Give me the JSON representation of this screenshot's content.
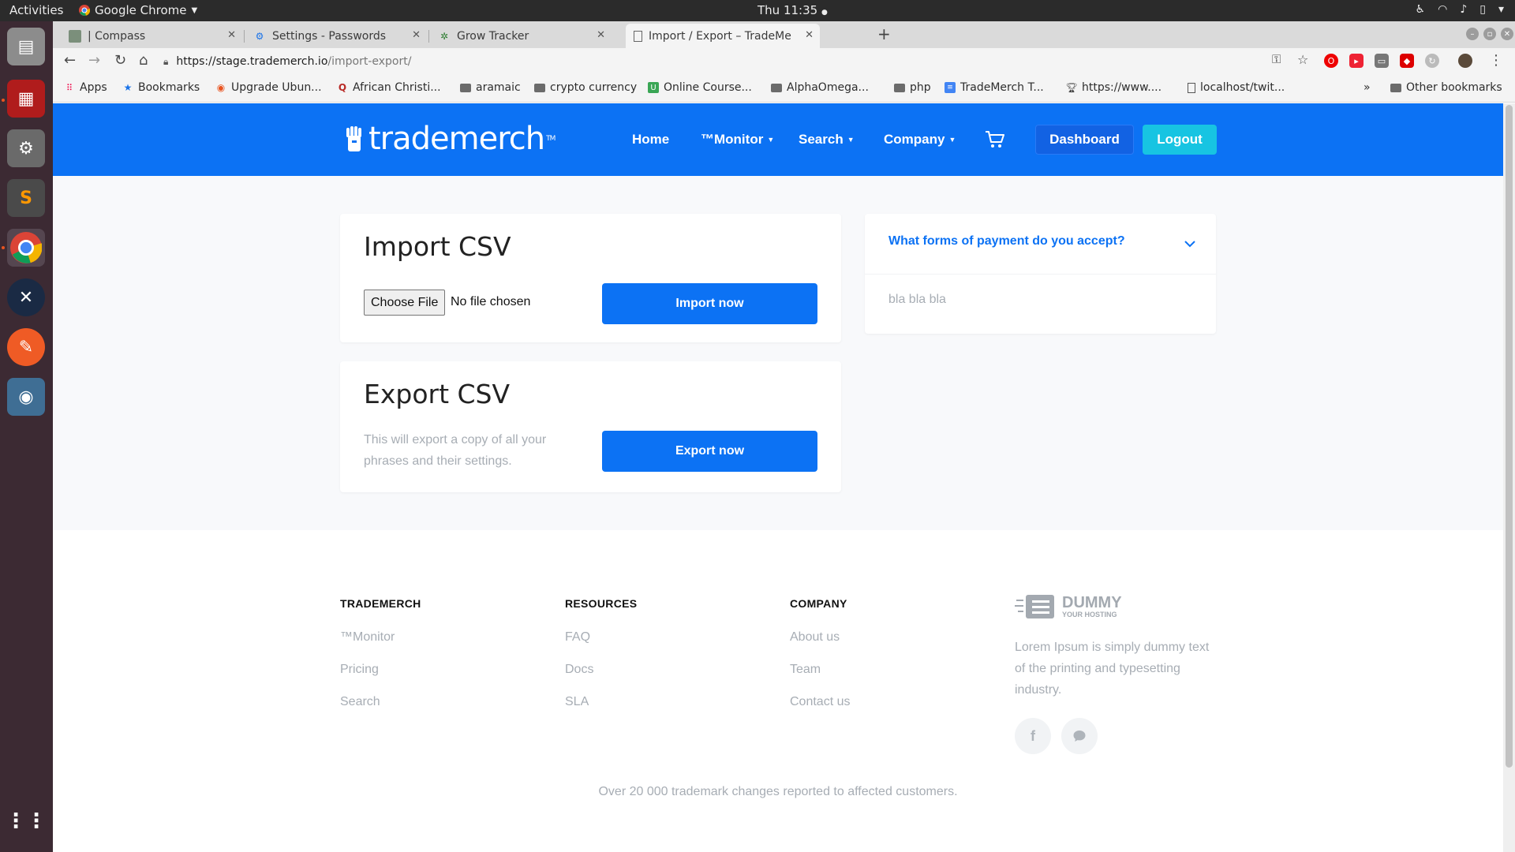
{
  "os": {
    "activities": "Activities",
    "app_name": "Google Chrome",
    "clock": "Thu 11:35"
  },
  "browser": {
    "tabs": [
      {
        "title": "| Compass",
        "active": false
      },
      {
        "title": "Settings - Passwords",
        "active": false
      },
      {
        "title": "Grow Tracker",
        "active": false
      },
      {
        "title": "Import / Export – TradeMe",
        "active": true
      }
    ],
    "url_host": "https://stage.trademerch.io",
    "url_path": "/import-export/",
    "bookmarks": [
      "Apps",
      "Bookmarks",
      "Upgrade Ubun...",
      "African Christi...",
      "aramaic",
      "crypto currency",
      "Online Course...",
      "AlphaOmega...",
      "php",
      "TradeMerch T...",
      "https://www....",
      "localhost/twit..."
    ],
    "bookmarks_overflow": "»",
    "other_bookmarks": "Other bookmarks"
  },
  "site": {
    "logo_text": "trademerch",
    "logo_tm": "TM",
    "nav": {
      "home": "Home",
      "monitor": "™Monitor",
      "search": "Search",
      "company": "Company"
    },
    "dashboard_label": "Dashboard",
    "logout_label": "Logout"
  },
  "import_card": {
    "title": "Import CSV",
    "choose_file_label": "Choose File",
    "file_status": "No file chosen",
    "button_label": "Import now"
  },
  "export_card": {
    "title": "Export CSV",
    "description": "This will export a copy of all your phrases and their settings.",
    "button_label": "Export now"
  },
  "faq": {
    "question": "What forms of payment do you accept?",
    "answer": "bla bla bla"
  },
  "footer": {
    "columns": [
      {
        "title": "TRADEMERCH",
        "links": [
          "™Monitor",
          "Pricing",
          "Search"
        ]
      },
      {
        "title": "RESOURCES",
        "links": [
          "FAQ",
          "Docs",
          "SLA"
        ]
      },
      {
        "title": "COMPANY",
        "links": [
          "About us",
          "Team",
          "Contact us"
        ]
      }
    ],
    "brand_name": "DUMMY",
    "brand_sub": "YOUR HOSTING",
    "blurb": "Lorem Ipsum is simply dummy text of the printing and typesetting industry.",
    "note": "Over 20 000 trademark changes reported to affected customers."
  },
  "colors": {
    "brand_blue": "#0c72f4",
    "logout_cyan": "#17c4e2",
    "muted_text": "#a7adb4"
  },
  "icons": [
    "chrome-icon",
    "search-icon",
    "key-icon",
    "star-icon",
    "cart-icon",
    "chevron-down-icon",
    "facebook-icon",
    "chat-icon"
  ]
}
